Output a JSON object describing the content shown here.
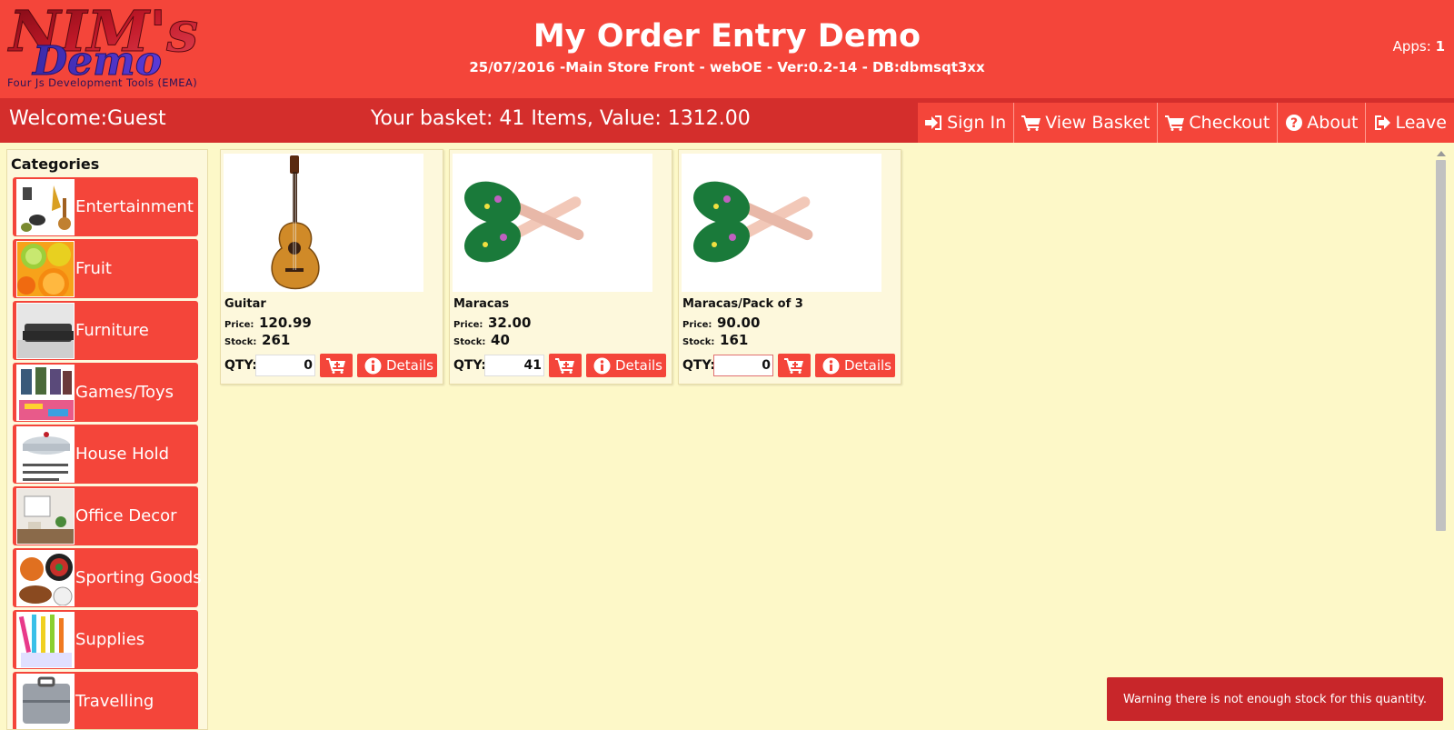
{
  "header": {
    "logo_line1": "NIM's",
    "logo_line2": "Demo",
    "logo_tagline": "Four Js Development Tools (EMEA)",
    "title": "My Order Entry Demo",
    "subtitle": "25/07/2016 -Main Store Front - webOE - Ver:0.2-14 - DB:dbmsqt3xx",
    "apps_label": "Apps:",
    "apps_count": "1"
  },
  "navbar": {
    "welcome": "Welcome:Guest",
    "basket": "Your basket: 41 Items, Value: 1312.00",
    "buttons": [
      {
        "label": "Sign In",
        "icon": "sign-in-icon"
      },
      {
        "label": "View Basket",
        "icon": "cart-icon"
      },
      {
        "label": "Checkout",
        "icon": "cart-icon"
      },
      {
        "label": "About",
        "icon": "question-circle-icon"
      },
      {
        "label": "Leave",
        "icon": "sign-out-icon"
      }
    ]
  },
  "sidebar": {
    "title": "Categories",
    "items": [
      {
        "label": "Entertainment"
      },
      {
        "label": "Fruit"
      },
      {
        "label": "Furniture"
      },
      {
        "label": "Games/Toys"
      },
      {
        "label": "House Hold"
      },
      {
        "label": "Office Decor"
      },
      {
        "label": "Sporting Goods"
      },
      {
        "label": "Supplies"
      },
      {
        "label": "Travelling"
      }
    ]
  },
  "products": {
    "price_label": "Price:",
    "stock_label": "Stock:",
    "qty_label": "QTY:",
    "details_label": "Details",
    "items": [
      {
        "name": "Guitar",
        "price": "120.99",
        "stock": "261",
        "qty": "0"
      },
      {
        "name": "Maracas",
        "price": "32.00",
        "stock": "40",
        "qty": "41"
      },
      {
        "name": "Maracas/Pack of 3",
        "price": "90.00",
        "stock": "161",
        "qty": "0"
      }
    ]
  },
  "toast": {
    "message": "Warning there is not enough stock for this quantity."
  },
  "colors": {
    "header_bg": "#f4453a",
    "navbar_bg": "#d42e2c",
    "page_bg": "#fdf8c8",
    "toast_bg": "#c8262a"
  }
}
